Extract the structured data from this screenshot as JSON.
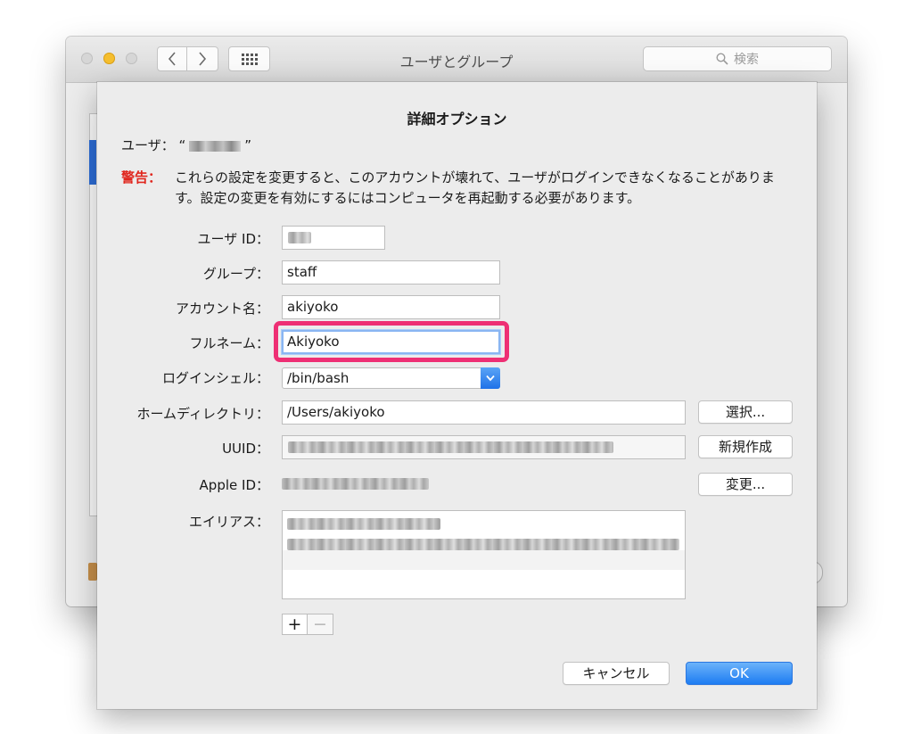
{
  "window": {
    "title": "ユーザとグループ",
    "search_placeholder": "検索"
  },
  "sheet": {
    "title": "詳細オプション",
    "user_label": "ユーザ：",
    "user_quote_open": "“",
    "user_quote_close": "”",
    "warning_label": "警告：",
    "warning_text": "これらの設定を変更すると、このアカウントが壊れて、ユーザがログインできなくなることがあります。設定の変更を有効にするにはコンピュータを再起動する必要があります。",
    "fields": {
      "user_id": {
        "label": "ユーザ ID：",
        "value": ""
      },
      "group": {
        "label": "グループ：",
        "value": "staff"
      },
      "account_name": {
        "label": "アカウント名：",
        "value": "akiyoko"
      },
      "full_name": {
        "label": "フルネーム：",
        "value": "Akiyoko"
      },
      "login_shell": {
        "label": "ログインシェル：",
        "value": "/bin/bash"
      },
      "home_directory": {
        "label": "ホームディレクトリ：",
        "value": "/Users/akiyoko",
        "button": "選択..."
      },
      "uuid": {
        "label": "UUID：",
        "value": "",
        "button": "新規作成"
      },
      "apple_id": {
        "label": "Apple ID：",
        "value": "",
        "button": "変更..."
      },
      "aliases": {
        "label": "エイリアス："
      }
    },
    "alias_controls": {
      "add": "+",
      "remove": "−"
    },
    "buttons": {
      "cancel": "キャンセル",
      "ok": "OK"
    }
  },
  "colors": {
    "warning": "#e0271e",
    "highlight": "#ee2f74",
    "accent": "#1d7cf2",
    "minimize": "#f5be2e"
  }
}
